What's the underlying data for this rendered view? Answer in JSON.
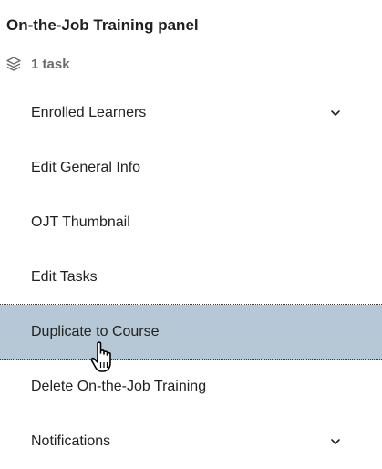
{
  "panel": {
    "title": "On-the-Job Training panel",
    "task_count_label": "1 task",
    "task_count_icon": "layers-icon"
  },
  "menu": {
    "items": [
      {
        "label": "Enrolled Learners",
        "has_chevron": true,
        "chevron_icon": "chevron-down-icon"
      },
      {
        "label": "Edit General Info",
        "has_chevron": false
      },
      {
        "label": "OJT Thumbnail",
        "has_chevron": false
      },
      {
        "label": "Edit Tasks",
        "has_chevron": false
      },
      {
        "label": "Duplicate to Course",
        "has_chevron": false,
        "state": "hovered"
      },
      {
        "label": "Delete On-the-Job Training",
        "has_chevron": false
      },
      {
        "label": "Notifications",
        "has_chevron": true,
        "chevron_icon": "chevron-down-icon"
      }
    ]
  },
  "colors": {
    "hover_background": "#b6c8d5",
    "text": "#222222",
    "muted_text": "#6b6b6b"
  },
  "cursor": {
    "icon": "hand-pointer-icon"
  }
}
